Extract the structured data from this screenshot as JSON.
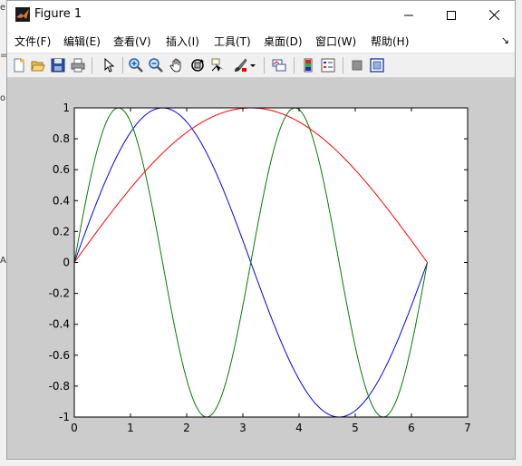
{
  "window": {
    "title": "Figure 1"
  },
  "menu": {
    "items": [
      "文件(F)",
      "编辑(E)",
      "查看(V)",
      "插入(I)",
      "工具(T)",
      "桌面(D)",
      "窗口(W)",
      "帮助(H)"
    ]
  },
  "toolbar": {
    "buttons": [
      "new-figure-icon",
      "open-file-icon",
      "save-icon",
      "print-icon",
      "pointer-icon",
      "zoom-in-icon",
      "zoom-out-icon",
      "pan-hand-icon",
      "rotate-3d-icon",
      "data-cursor-icon",
      "brush-icon",
      "brush-dropdown-icon",
      "link-plot-icon",
      "colorbar-icon",
      "legend-icon",
      "hide-plot-tools-icon",
      "show-plot-tools-icon"
    ]
  },
  "background_fragments": [
    "e",
    "=",
    "o",
    "A"
  ],
  "chart_data": {
    "type": "line",
    "title": "",
    "xlabel": "",
    "ylabel": "",
    "xlim": [
      0,
      7
    ],
    "ylim": [
      -1,
      1
    ],
    "xticks": [
      "0",
      "1",
      "2",
      "3",
      "4",
      "5",
      "6",
      "7"
    ],
    "yticks": [
      "-1",
      "-0.8",
      "-0.6",
      "-0.4",
      "-0.2",
      "0",
      "0.2",
      "0.4",
      "0.6",
      "0.8",
      "1"
    ],
    "grid": false,
    "legend": false,
    "x_range": [
      0,
      6.2832
    ],
    "series": [
      {
        "function": "sin(x)",
        "color": "#0000ff"
      },
      {
        "function": "sin(2x)",
        "color": "#007f00"
      },
      {
        "function": "sin(x/2)",
        "color": "#ff0000"
      }
    ]
  }
}
